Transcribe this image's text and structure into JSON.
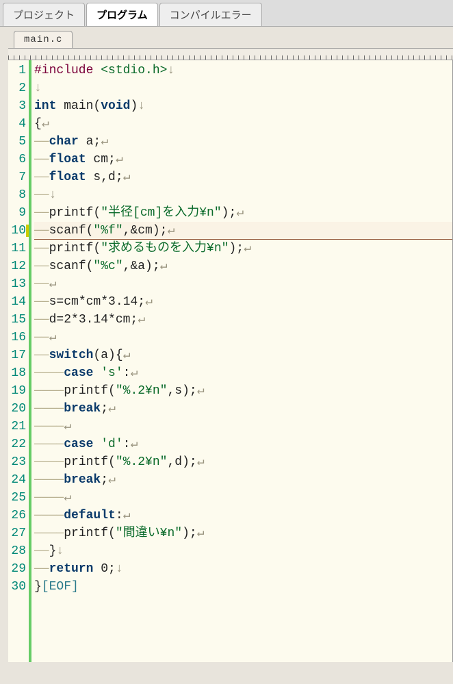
{
  "tabs": {
    "project": "プロジェクト",
    "program": "プログラム",
    "compile_error": "コンパイルエラー"
  },
  "file_tab": "main.c",
  "eof_label": "[EOF]",
  "code_lines": [
    {
      "n": 1,
      "tokens": [
        {
          "t": "#include ",
          "c": "pp"
        },
        {
          "t": "<stdio.h>",
          "c": "str"
        },
        {
          "t": "↓",
          "c": "nl"
        }
      ]
    },
    {
      "n": 2,
      "tokens": [
        {
          "t": "↓",
          "c": "nl"
        }
      ]
    },
    {
      "n": 3,
      "tokens": [
        {
          "t": "int ",
          "c": "kw"
        },
        {
          "t": "main(",
          "c": ""
        },
        {
          "t": "void",
          "c": "kw"
        },
        {
          "t": ")",
          "c": ""
        },
        {
          "t": "↓",
          "c": "nl"
        }
      ]
    },
    {
      "n": 4,
      "tokens": [
        {
          "t": "{",
          "c": ""
        },
        {
          "t": "↵",
          "c": "nl"
        }
      ]
    },
    {
      "n": 5,
      "tokens": [
        {
          "t": "――",
          "c": "ws"
        },
        {
          "t": "char ",
          "c": "kw"
        },
        {
          "t": "a;",
          "c": ""
        },
        {
          "t": "↵",
          "c": "nl"
        }
      ]
    },
    {
      "n": 6,
      "tokens": [
        {
          "t": "――",
          "c": "ws"
        },
        {
          "t": "float ",
          "c": "kw"
        },
        {
          "t": "cm;",
          "c": ""
        },
        {
          "t": "↵",
          "c": "nl"
        }
      ]
    },
    {
      "n": 7,
      "tokens": [
        {
          "t": "――",
          "c": "ws"
        },
        {
          "t": "float ",
          "c": "kw"
        },
        {
          "t": "s,d;",
          "c": ""
        },
        {
          "t": "↵",
          "c": "nl"
        }
      ]
    },
    {
      "n": 8,
      "tokens": [
        {
          "t": "――",
          "c": "ws"
        },
        {
          "t": "↓",
          "c": "nl"
        }
      ]
    },
    {
      "n": 9,
      "tokens": [
        {
          "t": "――",
          "c": "ws"
        },
        {
          "t": "printf(",
          "c": ""
        },
        {
          "t": "\"半径[cm]を入力¥n\"",
          "c": "str"
        },
        {
          "t": ");",
          "c": ""
        },
        {
          "t": "↵",
          "c": "nl"
        }
      ]
    },
    {
      "n": 10,
      "mark": true,
      "hl": true,
      "tokens": [
        {
          "t": "――",
          "c": "ws"
        },
        {
          "t": "scanf(",
          "c": ""
        },
        {
          "t": "\"%f\"",
          "c": "str"
        },
        {
          "t": ",&cm);",
          "c": ""
        },
        {
          "t": "↵",
          "c": "nl"
        }
      ]
    },
    {
      "n": 11,
      "tokens": [
        {
          "t": "――",
          "c": "ws"
        },
        {
          "t": "printf(",
          "c": ""
        },
        {
          "t": "\"求めるものを入力¥n\"",
          "c": "str"
        },
        {
          "t": ");",
          "c": ""
        },
        {
          "t": "↵",
          "c": "nl"
        }
      ]
    },
    {
      "n": 12,
      "tokens": [
        {
          "t": "――",
          "c": "ws"
        },
        {
          "t": "scanf(",
          "c": ""
        },
        {
          "t": "\"%c\"",
          "c": "str"
        },
        {
          "t": ",&a);",
          "c": ""
        },
        {
          "t": "↵",
          "c": "nl"
        }
      ]
    },
    {
      "n": 13,
      "tokens": [
        {
          "t": "――",
          "c": "ws"
        },
        {
          "t": "↵",
          "c": "nl"
        }
      ]
    },
    {
      "n": 14,
      "tokens": [
        {
          "t": "――",
          "c": "ws"
        },
        {
          "t": "s=cm*cm*3.14;",
          "c": ""
        },
        {
          "t": "↵",
          "c": "nl"
        }
      ]
    },
    {
      "n": 15,
      "tokens": [
        {
          "t": "――",
          "c": "ws"
        },
        {
          "t": "d=2*3.14*cm;",
          "c": ""
        },
        {
          "t": "↵",
          "c": "nl"
        }
      ]
    },
    {
      "n": 16,
      "tokens": [
        {
          "t": "――",
          "c": "ws"
        },
        {
          "t": "↵",
          "c": "nl"
        }
      ]
    },
    {
      "n": 17,
      "tokens": [
        {
          "t": "――",
          "c": "ws"
        },
        {
          "t": "switch",
          "c": "kw"
        },
        {
          "t": "(a){",
          "c": ""
        },
        {
          "t": "↵",
          "c": "nl"
        }
      ]
    },
    {
      "n": 18,
      "tokens": [
        {
          "t": "――――",
          "c": "ws"
        },
        {
          "t": "case ",
          "c": "kw"
        },
        {
          "t": "'s'",
          "c": "str"
        },
        {
          "t": ":",
          "c": ""
        },
        {
          "t": "↵",
          "c": "nl"
        }
      ]
    },
    {
      "n": 19,
      "tokens": [
        {
          "t": "――――",
          "c": "ws"
        },
        {
          "t": "printf(",
          "c": ""
        },
        {
          "t": "\"%.2¥n\"",
          "c": "str"
        },
        {
          "t": ",s);",
          "c": ""
        },
        {
          "t": "↵",
          "c": "nl"
        }
      ]
    },
    {
      "n": 20,
      "tokens": [
        {
          "t": "――――",
          "c": "ws"
        },
        {
          "t": "break",
          "c": "kw"
        },
        {
          "t": ";",
          "c": ""
        },
        {
          "t": "↵",
          "c": "nl"
        }
      ]
    },
    {
      "n": 21,
      "tokens": [
        {
          "t": "――――",
          "c": "ws"
        },
        {
          "t": "↵",
          "c": "nl"
        }
      ]
    },
    {
      "n": 22,
      "tokens": [
        {
          "t": "――――",
          "c": "ws"
        },
        {
          "t": "case ",
          "c": "kw"
        },
        {
          "t": "'d'",
          "c": "str"
        },
        {
          "t": ":",
          "c": ""
        },
        {
          "t": "↵",
          "c": "nl"
        }
      ]
    },
    {
      "n": 23,
      "tokens": [
        {
          "t": "――――",
          "c": "ws"
        },
        {
          "t": "printf(",
          "c": ""
        },
        {
          "t": "\"%.2¥n\"",
          "c": "str"
        },
        {
          "t": ",d);",
          "c": ""
        },
        {
          "t": "↵",
          "c": "nl"
        }
      ]
    },
    {
      "n": 24,
      "tokens": [
        {
          "t": "――――",
          "c": "ws"
        },
        {
          "t": "break",
          "c": "kw"
        },
        {
          "t": ";",
          "c": ""
        },
        {
          "t": "↵",
          "c": "nl"
        }
      ]
    },
    {
      "n": 25,
      "tokens": [
        {
          "t": "――――",
          "c": "ws"
        },
        {
          "t": "↵",
          "c": "nl"
        }
      ]
    },
    {
      "n": 26,
      "tokens": [
        {
          "t": "――――",
          "c": "ws"
        },
        {
          "t": "default",
          "c": "kw"
        },
        {
          "t": ":",
          "c": ""
        },
        {
          "t": "↵",
          "c": "nl"
        }
      ]
    },
    {
      "n": 27,
      "tokens": [
        {
          "t": "――――",
          "c": "ws"
        },
        {
          "t": "printf(",
          "c": ""
        },
        {
          "t": "\"間違い¥n\"",
          "c": "str"
        },
        {
          "t": ");",
          "c": ""
        },
        {
          "t": "↵",
          "c": "nl"
        }
      ]
    },
    {
      "n": 28,
      "tokens": [
        {
          "t": "――",
          "c": "ws"
        },
        {
          "t": "}",
          "c": ""
        },
        {
          "t": "↓",
          "c": "nl"
        }
      ]
    },
    {
      "n": 29,
      "tokens": [
        {
          "t": "――",
          "c": "ws"
        },
        {
          "t": "return ",
          "c": "kw"
        },
        {
          "t": "0;",
          "c": ""
        },
        {
          "t": "↓",
          "c": "nl"
        }
      ]
    },
    {
      "n": 30,
      "tokens": [
        {
          "t": "}",
          "c": ""
        },
        {
          "t": "[EOF]",
          "c": "eof"
        }
      ]
    }
  ]
}
